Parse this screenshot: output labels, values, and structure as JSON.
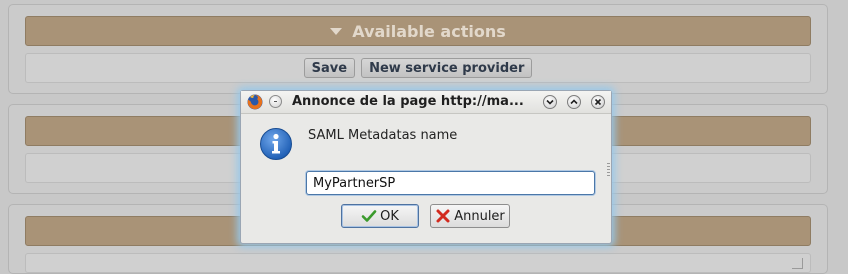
{
  "background": {
    "actions_header": "Available actions",
    "buttons": {
      "save": "Save",
      "new_service_provider": "New service provider"
    }
  },
  "dialog": {
    "title": "Annonce de la page http://ma...",
    "prompt": "SAML Metadatas name",
    "input_value": "MyPartnerSP",
    "ok_label": "OK",
    "cancel_label": "Annuler"
  },
  "colors": {
    "header_accent": "#a99377",
    "focus_glow": "#96c8eb",
    "info_blue": "#1f5fb5"
  },
  "icons": {
    "firefox": "firefox-icon",
    "info": "info-icon",
    "ok": "checkmark-icon",
    "cancel": "red-x-icon"
  }
}
